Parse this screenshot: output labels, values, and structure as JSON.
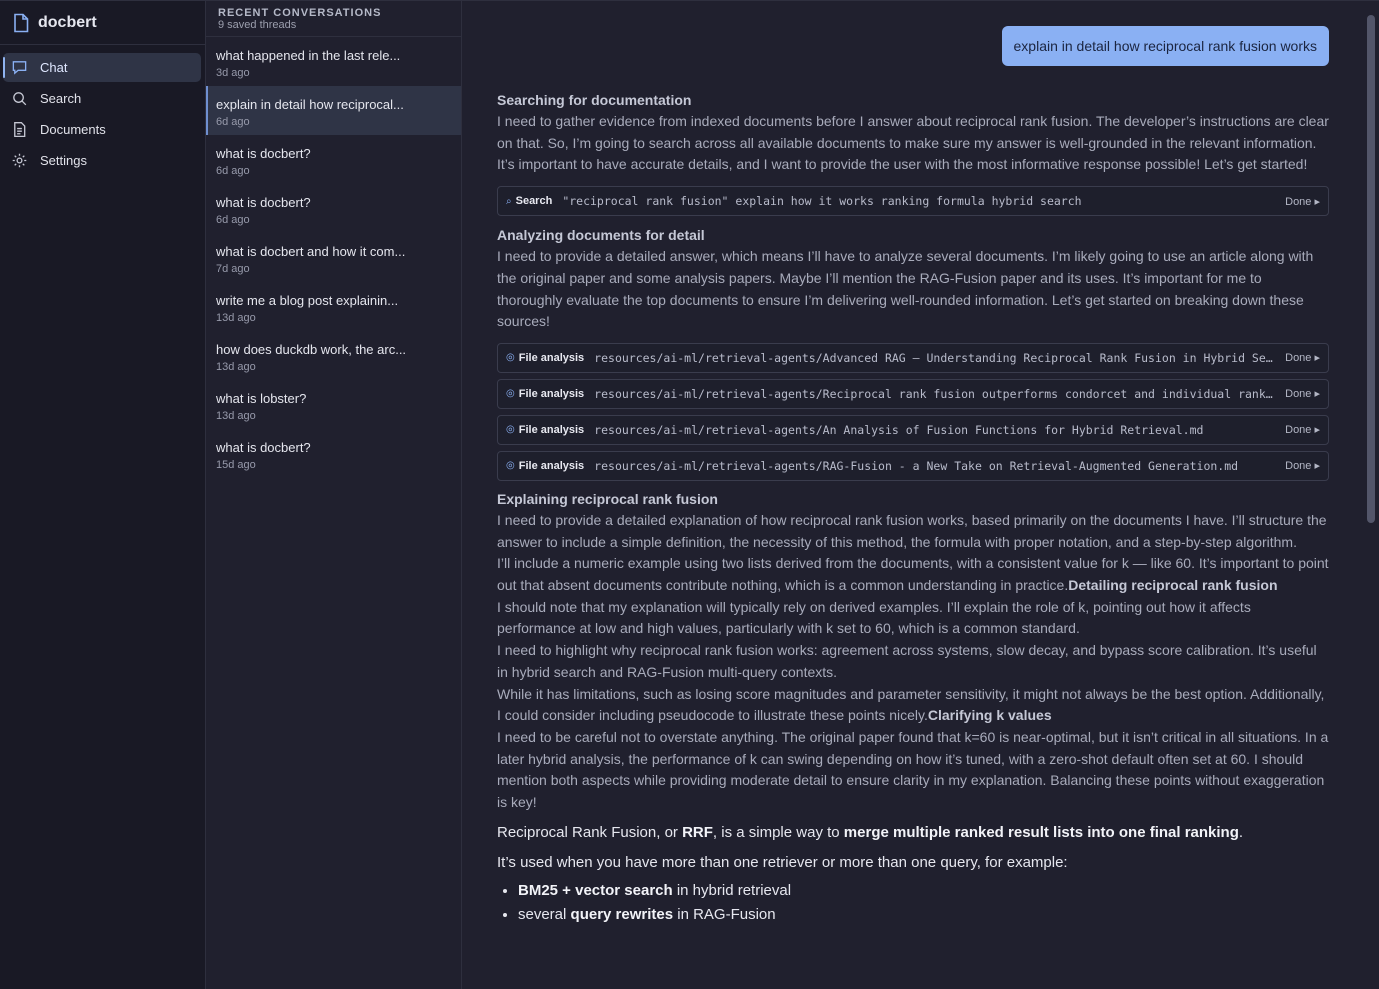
{
  "app": {
    "name": "docbert"
  },
  "nav": [
    {
      "label": "Chat",
      "icon": "chat-icon",
      "active": true
    },
    {
      "label": "Search",
      "icon": "search-icon",
      "active": false
    },
    {
      "label": "Documents",
      "icon": "document-icon",
      "active": false
    },
    {
      "label": "Settings",
      "icon": "gear-icon",
      "active": false
    }
  ],
  "threads": {
    "header": "RECENT CONVERSATIONS",
    "count_label": "9 saved threads",
    "items": [
      {
        "title": "what happened in the last rele...",
        "ago": "3d ago"
      },
      {
        "title": "explain in detail how reciprocal...",
        "ago": "6d ago",
        "active": true
      },
      {
        "title": "what is docbert?",
        "ago": "6d ago"
      },
      {
        "title": "what is docbert?",
        "ago": "6d ago"
      },
      {
        "title": "what is docbert and how it com...",
        "ago": "7d ago"
      },
      {
        "title": "write me a blog post explainin...",
        "ago": "13d ago"
      },
      {
        "title": "how does duckdb work, the arc...",
        "ago": "13d ago"
      },
      {
        "title": "what is lobster?",
        "ago": "13d ago"
      },
      {
        "title": "what is docbert?",
        "ago": "15d ago"
      }
    ]
  },
  "chat": {
    "user_message": "explain in detail how reciprocal rank fusion works",
    "reasoning": [
      {
        "title": "Searching for documentation",
        "body": "I need to gather evidence from indexed documents before I answer about reciprocal rank fusion. The developer’s instructions are clear on that. So, I’m going to search across all available documents to make sure my answer is well-grounded in the relevant information. It’s important to have accurate details, and I want to provide the user with the most informative response possible! Let’s get started!"
      },
      {
        "title": "Analyzing documents for detail",
        "body": "I need to provide a detailed answer, which means I’ll have to analyze several documents. I’m likely going to use an article along with the original paper and some analysis papers. Maybe I’ll mention the RAG-Fusion paper and its uses. It’s important for me to thoroughly evaluate the top documents to ensure I’m delivering well-rounded information. Let’s get started on breaking down these sources!"
      },
      {
        "title": "Explaining reciprocal rank fusion",
        "p1": "I need to provide a detailed explanation of how reciprocal rank fusion works, based primarily on the documents I have. I’ll structure the answer to include a simple definition, the necessity of this method, the formula with proper notation, and a step-by-step algorithm.",
        "p2": "I’ll include a numeric example using two lists derived from the documents, with a consistent value for k — like 60. It’s important to point out that absent documents contribute nothing, which is a common understanding in practice.",
        "p2_heading": "Detailing reciprocal rank fusion",
        "p3": "I should note that my explanation will typically rely on derived examples. I’ll explain the role of k, pointing out how it affects performance at low and high values, particularly with k set to 60, which is a common standard.",
        "p4": "I need to highlight why reciprocal rank fusion works: agreement across systems, slow decay, and bypass score calibration. It’s useful in hybrid search and RAG-Fusion multi-query contexts.",
        "p5": "While it has limitations, such as losing score magnitudes and parameter sensitivity, it might not always be the best option. Additionally, I could consider including pseudocode to illustrate these points nicely.",
        "p5_heading": "Clarifying k values",
        "p6": "I need to be careful not to overstate anything. The original paper found that k=60 is near-optimal, but it isn’t critical in all situations. In a later hybrid analysis, the performance of k can swing depending on how it’s tuned, with a zero-shot default often set at 60. I should mention both aspects while providing moderate detail to ensure clarity in my explanation. Balancing these points without exaggeration is key!"
      }
    ],
    "search_tool": {
      "kind": "Search",
      "query": "\"reciprocal rank fusion\" explain how it works ranking formula hybrid search",
      "status": "Done ▸"
    },
    "file_tools": [
      {
        "kind": "File analysis",
        "path": "resources/ai-ml/retrieval-agents/Advanced RAG — Understanding Reciprocal Rank Fusion in Hybrid Search.md",
        "status": "Done ▸"
      },
      {
        "kind": "File analysis",
        "path": "resources/ai-ml/retrieval-agents/Reciprocal rank fusion outperforms condorcet and individual rank learning methods.md",
        "status": "Done ▸"
      },
      {
        "kind": "File analysis",
        "path": "resources/ai-ml/retrieval-agents/An Analysis of Fusion Functions for Hybrid Retrieval.md",
        "status": "Done ▸"
      },
      {
        "kind": "File analysis",
        "path": "resources/ai-ml/retrieval-agents/RAG-Fusion - a New Take on Retrieval-Augmented Generation.md",
        "status": "Done ▸"
      }
    ],
    "answer": {
      "p1_a": "Reciprocal Rank Fusion, or ",
      "p1_b": "RRF",
      "p1_c": ", is a simple way to ",
      "p1_d": "merge multiple ranked result lists into one final ranking",
      "p1_e": ".",
      "p2": "It’s used when you have more than one retriever or more than one query, for example:",
      "li1_a": "BM25 + vector search",
      "li1_b": " in hybrid retrieval",
      "li2_a": "several ",
      "li2_b": "query rewrites",
      "li2_c": " in RAG-Fusion"
    }
  }
}
